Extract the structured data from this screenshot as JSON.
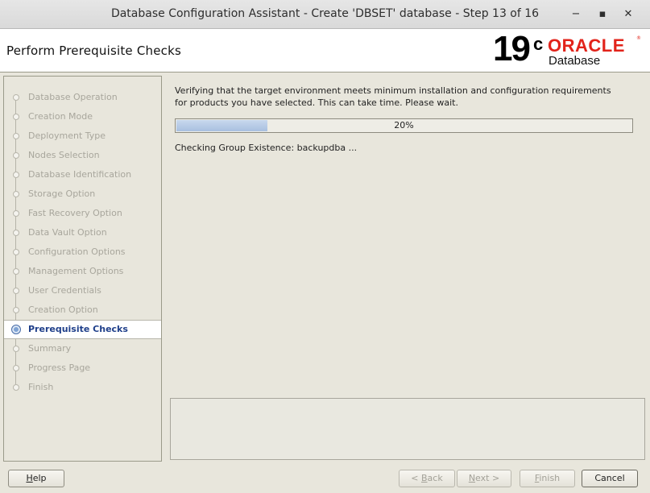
{
  "window": {
    "title": "Database Configuration Assistant - Create 'DBSET' database - Step 13 of 16",
    "controls": {
      "minimize": "−",
      "maximize": "▪",
      "close": "✕"
    }
  },
  "header": {
    "page_title": "Perform Prerequisite Checks",
    "logo": {
      "version": "19",
      "version_sup": "c",
      "brand": "ORACLE",
      "reg": "®",
      "product": "Database",
      "brand_color": "#e2231a"
    }
  },
  "sidebar": {
    "steps": [
      {
        "label": "Database Operation",
        "state": "done"
      },
      {
        "label": "Creation Mode",
        "state": "done"
      },
      {
        "label": "Deployment Type",
        "state": "done"
      },
      {
        "label": "Nodes Selection",
        "state": "done"
      },
      {
        "label": "Database Identification",
        "state": "done"
      },
      {
        "label": "Storage Option",
        "state": "done"
      },
      {
        "label": "Fast Recovery Option",
        "state": "done"
      },
      {
        "label": "Data Vault Option",
        "state": "done"
      },
      {
        "label": "Configuration Options",
        "state": "done"
      },
      {
        "label": "Management Options",
        "state": "done"
      },
      {
        "label": "User Credentials",
        "state": "done"
      },
      {
        "label": "Creation Option",
        "state": "done"
      },
      {
        "label": "Prerequisite Checks",
        "state": "active"
      },
      {
        "label": "Summary",
        "state": "pending"
      },
      {
        "label": "Progress Page",
        "state": "pending"
      },
      {
        "label": "Finish",
        "state": "pending"
      }
    ]
  },
  "content": {
    "description_line1": "Verifying that the target environment meets minimum installation and configuration requirements",
    "description_line2": "for products you have selected. This can take time. Please wait.",
    "progress": {
      "percent": 20,
      "label": "20%"
    },
    "status": "Checking Group Existence: backupdba ..."
  },
  "footer": {
    "help": {
      "label_mnemonic": "H",
      "label_rest": "elp"
    },
    "back": {
      "label_pre": "< ",
      "label_mnemonic": "B",
      "label_rest": "ack"
    },
    "next": {
      "label_mnemonic": "N",
      "label_rest": "ext >"
    },
    "finish": {
      "label_mnemonic": "F",
      "label_rest": "inish"
    },
    "cancel": {
      "label": "Cancel"
    }
  }
}
